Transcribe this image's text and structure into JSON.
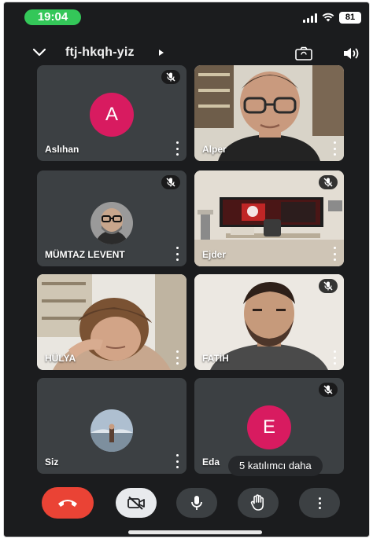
{
  "status_bar": {
    "time": "19:04",
    "battery": "81"
  },
  "header": {
    "meeting_code": "ftj-hkqh-yiz"
  },
  "participants": [
    {
      "name": "Aslıhan",
      "avatar_letter": "A",
      "muted": true
    },
    {
      "name": "Alper",
      "muted": false
    },
    {
      "name": "MÜMTAZ LEVENT",
      "muted": true
    },
    {
      "name": "Ejder",
      "muted": true
    },
    {
      "name": "HÜLYA",
      "muted": false
    },
    {
      "name": "FATİH",
      "muted": true
    },
    {
      "name": "Siz",
      "muted": false
    },
    {
      "name": "Eda",
      "avatar_letter": "E",
      "muted": true
    }
  ],
  "more_participants_label": "5 katılımcı daha",
  "colors": {
    "end_call": "#ea4335",
    "avatar": "#d81b60",
    "tile": "#3c4043",
    "background": "#1b1c1e"
  }
}
